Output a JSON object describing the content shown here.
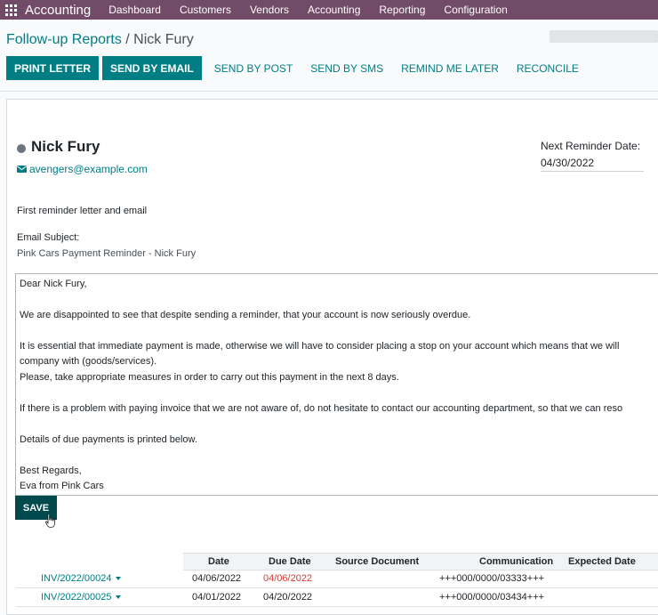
{
  "navbar": {
    "app_name": "Accounting",
    "menu": [
      "Dashboard",
      "Customers",
      "Vendors",
      "Accounting",
      "Reporting",
      "Configuration"
    ]
  },
  "breadcrumb": {
    "parent": "Follow-up Reports",
    "separator": " / ",
    "current": "Nick Fury"
  },
  "toolbar": {
    "print_letter": "PRINT LETTER",
    "send_by_email": "SEND BY EMAIL",
    "send_by_post": "SEND BY POST",
    "send_by_sms": "SEND BY SMS",
    "remind_me_later": "REMIND ME LATER",
    "reconcile": "RECONCILE"
  },
  "partner": {
    "name": "Nick Fury",
    "email": "avengers@example.com"
  },
  "reminder": {
    "label": "Next Reminder Date:",
    "date": "04/30/2022"
  },
  "followup": {
    "level_name": "First reminder letter and email",
    "subject_label": "Email Subject:",
    "subject_value": "Pink Cars Payment Reminder - Nick Fury"
  },
  "email_body": [
    "Dear Nick Fury,",
    "We are disappointed to see that despite sending a reminder, that your account is now seriously overdue.",
    "It is essential that immediate payment is made, otherwise we will have to consider placing a stop on your account which means that we will",
    "company with (goods/services).",
    "Please, take appropriate measures in order to carry out this payment in the next 8 days.",
    "If there is a problem with paying invoice that we are not aware of, do not hesitate to contact our accounting department, so that we can reso",
    "Details of due payments is printed below.",
    "Best Regards,",
    "Eva from Pink Cars"
  ],
  "save_label": "SAVE",
  "table": {
    "headers": [
      "Date",
      "Due Date",
      "Source Document",
      "Communication",
      "Expected Date"
    ],
    "rows": [
      {
        "invoice": "INV/2022/00024",
        "date": "04/06/2022",
        "due_date": "04/06/2022",
        "source": "",
        "communication": "+++000/0000/03333+++",
        "expected": ""
      },
      {
        "invoice": "INV/2022/00025",
        "date": "04/01/2022",
        "due_date": "04/20/2022",
        "source": "",
        "communication": "+++000/0000/03434+++",
        "expected": ""
      }
    ]
  },
  "colors": {
    "navbar": "#714b67",
    "primary": "#017e84",
    "overdue": "#d23f3a",
    "save": "#00494d"
  }
}
